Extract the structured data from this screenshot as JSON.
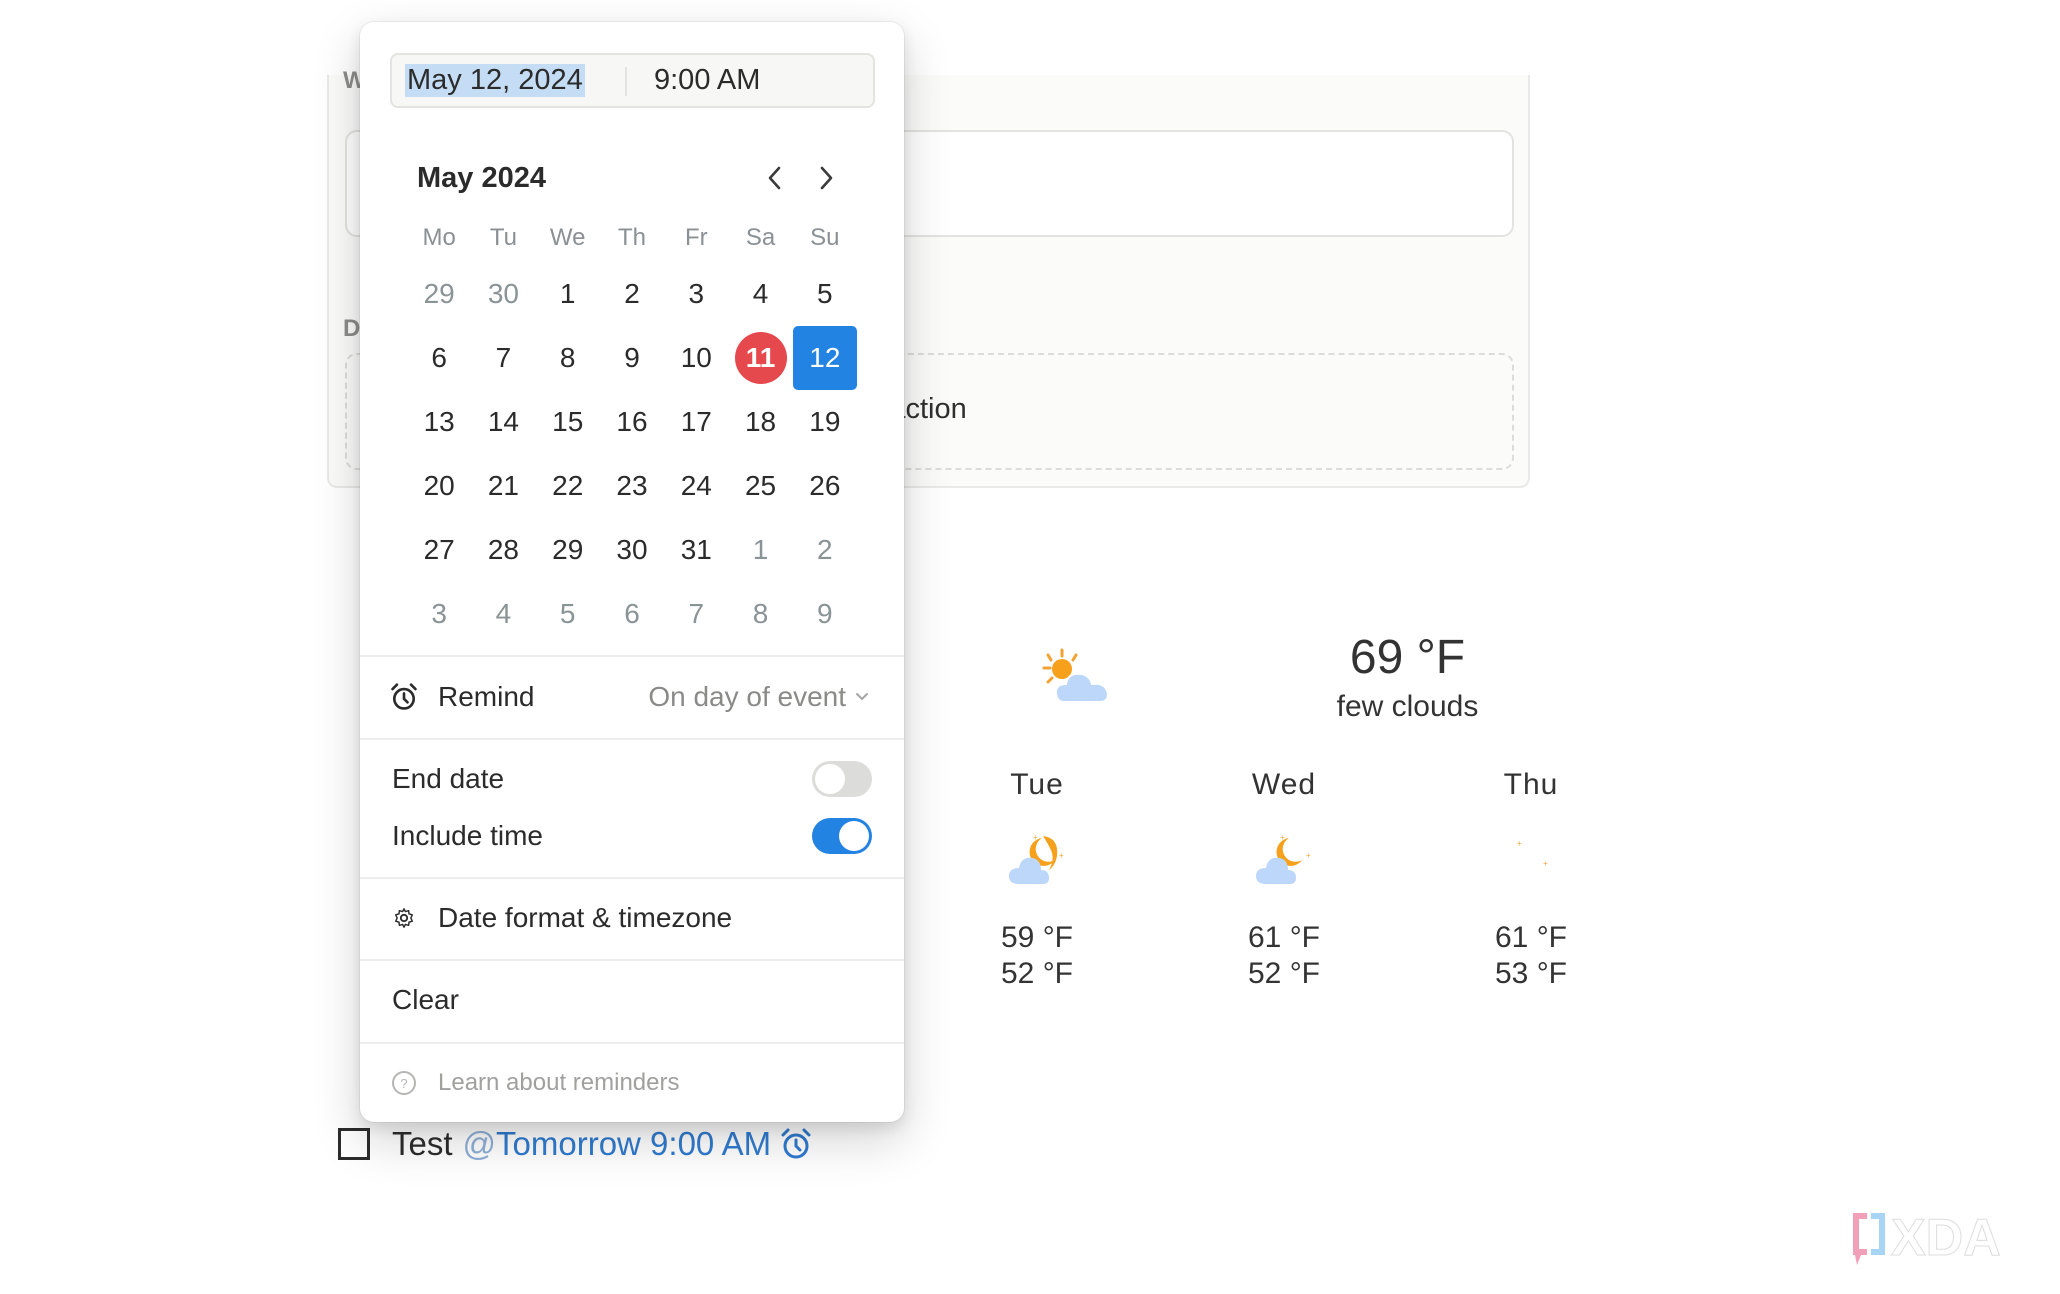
{
  "background_panel": {
    "label_top_partial": "W",
    "label_mid_partial": "D",
    "add_action_partial": "dd action"
  },
  "date_picker": {
    "date_value": "May 12, 2024",
    "time_value": "9:00 AM",
    "month_label": "May 2024",
    "prev_icon": "chevron-left-icon",
    "next_icon": "chevron-right-icon",
    "weekdays": [
      "Mo",
      "Tu",
      "We",
      "Th",
      "Fr",
      "Sa",
      "Su"
    ],
    "weeks": [
      [
        {
          "d": "29",
          "m": true
        },
        {
          "d": "30",
          "m": true
        },
        {
          "d": "1"
        },
        {
          "d": "2"
        },
        {
          "d": "3"
        },
        {
          "d": "4"
        },
        {
          "d": "5"
        }
      ],
      [
        {
          "d": "6"
        },
        {
          "d": "7"
        },
        {
          "d": "8"
        },
        {
          "d": "9"
        },
        {
          "d": "10"
        },
        {
          "d": "11",
          "today": true
        },
        {
          "d": "12",
          "selected": true
        }
      ],
      [
        {
          "d": "13"
        },
        {
          "d": "14"
        },
        {
          "d": "15"
        },
        {
          "d": "16"
        },
        {
          "d": "17"
        },
        {
          "d": "18"
        },
        {
          "d": "19"
        }
      ],
      [
        {
          "d": "20"
        },
        {
          "d": "21"
        },
        {
          "d": "22"
        },
        {
          "d": "23"
        },
        {
          "d": "24"
        },
        {
          "d": "25"
        },
        {
          "d": "26"
        }
      ],
      [
        {
          "d": "27"
        },
        {
          "d": "28"
        },
        {
          "d": "29"
        },
        {
          "d": "30"
        },
        {
          "d": "31"
        },
        {
          "d": "1",
          "m": true
        },
        {
          "d": "2",
          "m": true
        }
      ],
      [
        {
          "d": "3",
          "m": true
        },
        {
          "d": "4",
          "m": true
        },
        {
          "d": "5",
          "m": true
        },
        {
          "d": "6",
          "m": true
        },
        {
          "d": "7",
          "m": true
        },
        {
          "d": "8",
          "m": true
        },
        {
          "d": "9",
          "m": true
        }
      ]
    ],
    "today_color": "#e5484d",
    "selected_color": "#2383e2",
    "remind": {
      "label": "Remind",
      "value": "On day of event",
      "icon": "alarm-clock-icon"
    },
    "end_date": {
      "label": "End date",
      "enabled": false
    },
    "include_time": {
      "label": "Include time",
      "enabled": true
    },
    "date_format": {
      "label": "Date format & timezone",
      "icon": "gear-icon"
    },
    "clear": {
      "label": "Clear"
    },
    "learn": {
      "label": "Learn about reminders",
      "icon": "help-circle-icon"
    }
  },
  "weather": {
    "current": {
      "temp": "69 °F",
      "desc": "few clouds",
      "icon": "sun-behind-cloud-icon"
    },
    "forecast": [
      {
        "day": "Tue",
        "high": "59 °F",
        "low": "52 °F",
        "icon": "moon-behind-cloud-icon"
      },
      {
        "day": "Wed",
        "high": "61 °F",
        "low": "52 °F",
        "icon": "moon-behind-cloud-icon"
      },
      {
        "day": "Thu",
        "high": "61 °F",
        "low": "53 °F",
        "icon": "crescent-moon-icon"
      }
    ]
  },
  "task": {
    "checked": false,
    "title": "Test",
    "mention_at": "@",
    "mention": "Tomorrow 9:00 AM",
    "reminder_icon": "alarm-clock-icon"
  },
  "watermark": {
    "text": "XDA"
  }
}
